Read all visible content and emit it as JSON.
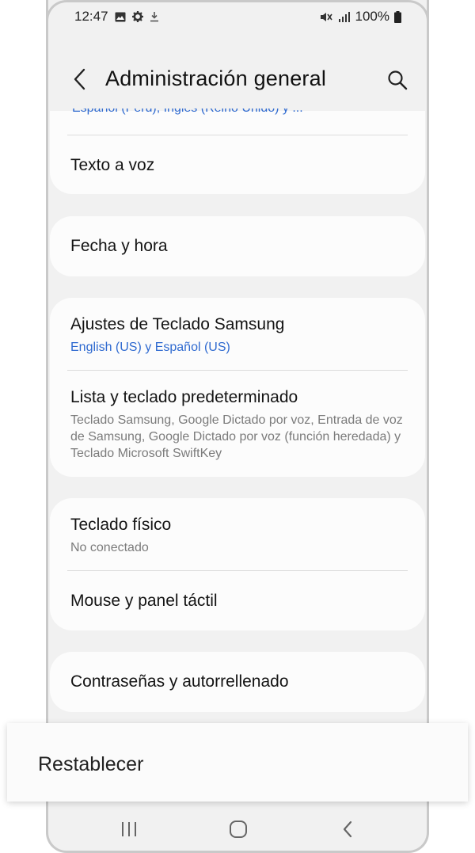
{
  "status_bar": {
    "time": "12:47",
    "battery_text": "100%",
    "left_icons": [
      "image-icon",
      "gear-icon",
      "download-icon"
    ],
    "right_icons": [
      "mute-vibrate-icon",
      "signal-icon",
      "battery-icon"
    ]
  },
  "header": {
    "title": "Administración general",
    "back_icon": "chevron-left-icon",
    "search_icon": "search-icon"
  },
  "sections": [
    {
      "partial_subtitle": "Español (Perú), Inglés (Reino Unido) y ...",
      "items": [
        {
          "title": "Texto a voz"
        }
      ]
    },
    {
      "items": [
        {
          "title": "Fecha y hora"
        }
      ]
    },
    {
      "items": [
        {
          "title": "Ajustes de Teclado Samsung",
          "subtitle": "English (US) y Español (US)"
        },
        {
          "title": "Lista y teclado predeterminado",
          "subtitle": "Teclado Samsung, Google Dictado por voz, Entrada de voz de Samsung, Google Dictado por voz (función heredada) y Teclado Microsoft SwiftKey"
        }
      ]
    },
    {
      "items": [
        {
          "title": "Teclado físico",
          "subtitle": "No conectado"
        },
        {
          "title": "Mouse y panel táctil"
        }
      ]
    },
    {
      "items": [
        {
          "title": "Contraseñas y autorrellenado"
        }
      ]
    }
  ],
  "highlight": {
    "label": "Restablecer"
  },
  "nav_bar": {
    "icons": [
      "recent-apps-icon",
      "home-icon",
      "back-icon"
    ]
  },
  "colors": {
    "accent_blue": "#2f6ad0",
    "background": "#f1f1f1",
    "card": "#fcfcfc"
  }
}
